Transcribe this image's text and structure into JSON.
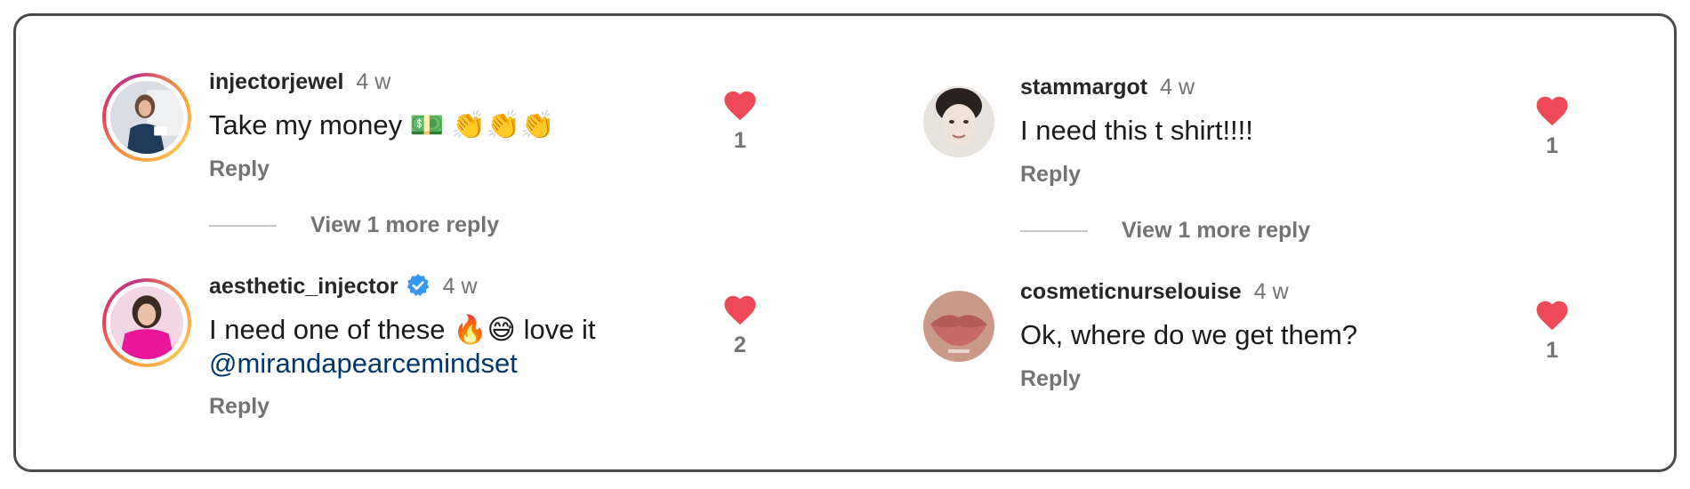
{
  "comments": [
    {
      "username": "injectorjewel",
      "time": "4 w",
      "text": "Take my money 💵 👏👏👏",
      "reply_label": "Reply",
      "likes": "1",
      "more_replies": "View 1 more reply"
    },
    {
      "username": "aesthetic_injector",
      "time": "4 w",
      "verified": true,
      "text_line1": "I need one of these 🔥😅 love it",
      "mention": "@mirandapearcemindset",
      "reply_label": "Reply",
      "likes": "2"
    },
    {
      "username": "stammargot",
      "time": "4 w",
      "text": "I need this t shirt!!!!",
      "reply_label": "Reply",
      "likes": "1",
      "more_replies": "View 1 more reply"
    },
    {
      "username": "cosmeticnurselouise",
      "time": "4 w",
      "text": "Ok, where do we get them?",
      "reply_label": "Reply",
      "likes": "1"
    }
  ],
  "colors": {
    "heart": "#ed4956",
    "secondary_text": "#737373",
    "mention": "#00376b",
    "verified": "#3897f0"
  }
}
